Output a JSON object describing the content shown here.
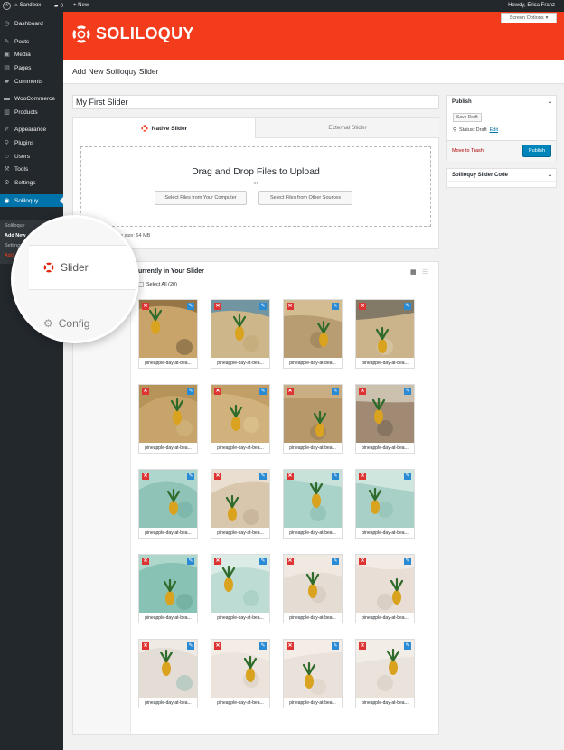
{
  "admin_bar": {
    "site_name": "Sandbox",
    "comments_count": "0",
    "new_label": "+ New",
    "howdy": "Howdy, Erica Franz"
  },
  "sidebar": {
    "items": [
      {
        "label": "Dashboard",
        "icon": "dashboard-icon",
        "glyph": "◷"
      },
      {
        "label": "Posts",
        "icon": "pin-icon",
        "glyph": "✎"
      },
      {
        "label": "Media",
        "icon": "media-icon",
        "glyph": "▣"
      },
      {
        "label": "Pages",
        "icon": "pages-icon",
        "glyph": "▤"
      },
      {
        "label": "Comments",
        "icon": "comment-icon",
        "glyph": "▰"
      },
      {
        "label": "WooCommerce",
        "icon": "woo-icon",
        "glyph": "▬"
      },
      {
        "label": "Products",
        "icon": "products-icon",
        "glyph": "▥"
      },
      {
        "label": "Appearance",
        "icon": "brush-icon",
        "glyph": "✐"
      },
      {
        "label": "Plugins",
        "icon": "plugin-icon",
        "glyph": "⚲"
      },
      {
        "label": "Users",
        "icon": "user-icon",
        "glyph": "☺"
      },
      {
        "label": "Tools",
        "icon": "wrench-icon",
        "glyph": "⚒"
      },
      {
        "label": "Settings",
        "icon": "settings-icon",
        "glyph": "⚙"
      },
      {
        "label": "Soliloquy",
        "icon": "soliloquy-icon",
        "glyph": "◉"
      }
    ],
    "submenu": [
      "Soliloquy",
      "Add New",
      "Settings",
      "Add"
    ]
  },
  "brand": {
    "logo_text": "SOLILOQUY",
    "color": "#f23c1c"
  },
  "screen_options": "Screen Options",
  "page_title": "Add New Soliloquy Slider",
  "slider_title_value": "My First Slider",
  "tabs": {
    "native": "Native Slider",
    "external": "External Slider"
  },
  "upload": {
    "heading": "Drag and Drop Files to Upload",
    "or": "or",
    "btn_computer": "Select Files from Your Computer",
    "btn_other": "Select Files from Other Sources",
    "max_size": "e size: 64 MB"
  },
  "images_panel": {
    "heading": "urrently in Your Slider",
    "select_all": "Select All (20)",
    "grid_view_icon": "grid-view-icon",
    "list_view_icon": "list-view-icon"
  },
  "images": [
    {
      "caption": "pineapple-day-at-bea..."
    },
    {
      "caption": "pineapple-day-at-bea..."
    },
    {
      "caption": "pineapple-day-at-bea..."
    },
    {
      "caption": "pineapple-day-at-bea..."
    },
    {
      "caption": "pineapple-day-at-bea..."
    },
    {
      "caption": "pineapple-day-at-bea..."
    },
    {
      "caption": "pineapple-day-at-bea..."
    },
    {
      "caption": "pineapple-day-at-bea..."
    },
    {
      "caption": "pineapple-day-at-bea..."
    },
    {
      "caption": "pineapple-day-at-bea..."
    },
    {
      "caption": "pineapple-day-at-bea..."
    },
    {
      "caption": "pineapple-day-at-bea..."
    },
    {
      "caption": "pineapple-day-at-bea..."
    },
    {
      "caption": "pineapple-day-at-bea..."
    },
    {
      "caption": "pineapple-day-at-bea..."
    },
    {
      "caption": "pineapple-day-at-bea..."
    },
    {
      "caption": "pineapple-day-at-bea..."
    },
    {
      "caption": "pineapple-day-at-bea..."
    },
    {
      "caption": "pineapple-day-at-bea..."
    },
    {
      "caption": "pineapple-day-at-bea..."
    }
  ],
  "publish_box": {
    "title": "Publish",
    "save_draft": "Save Draft",
    "status_label": "Status: Draft",
    "edit_link": "Edit",
    "trash": "Move to Trash",
    "publish": "Publish"
  },
  "code_box": {
    "title": "Soliloquy Slider Code"
  },
  "magnifier": {
    "slider_tab": "Slider",
    "config_tab": "Config"
  }
}
